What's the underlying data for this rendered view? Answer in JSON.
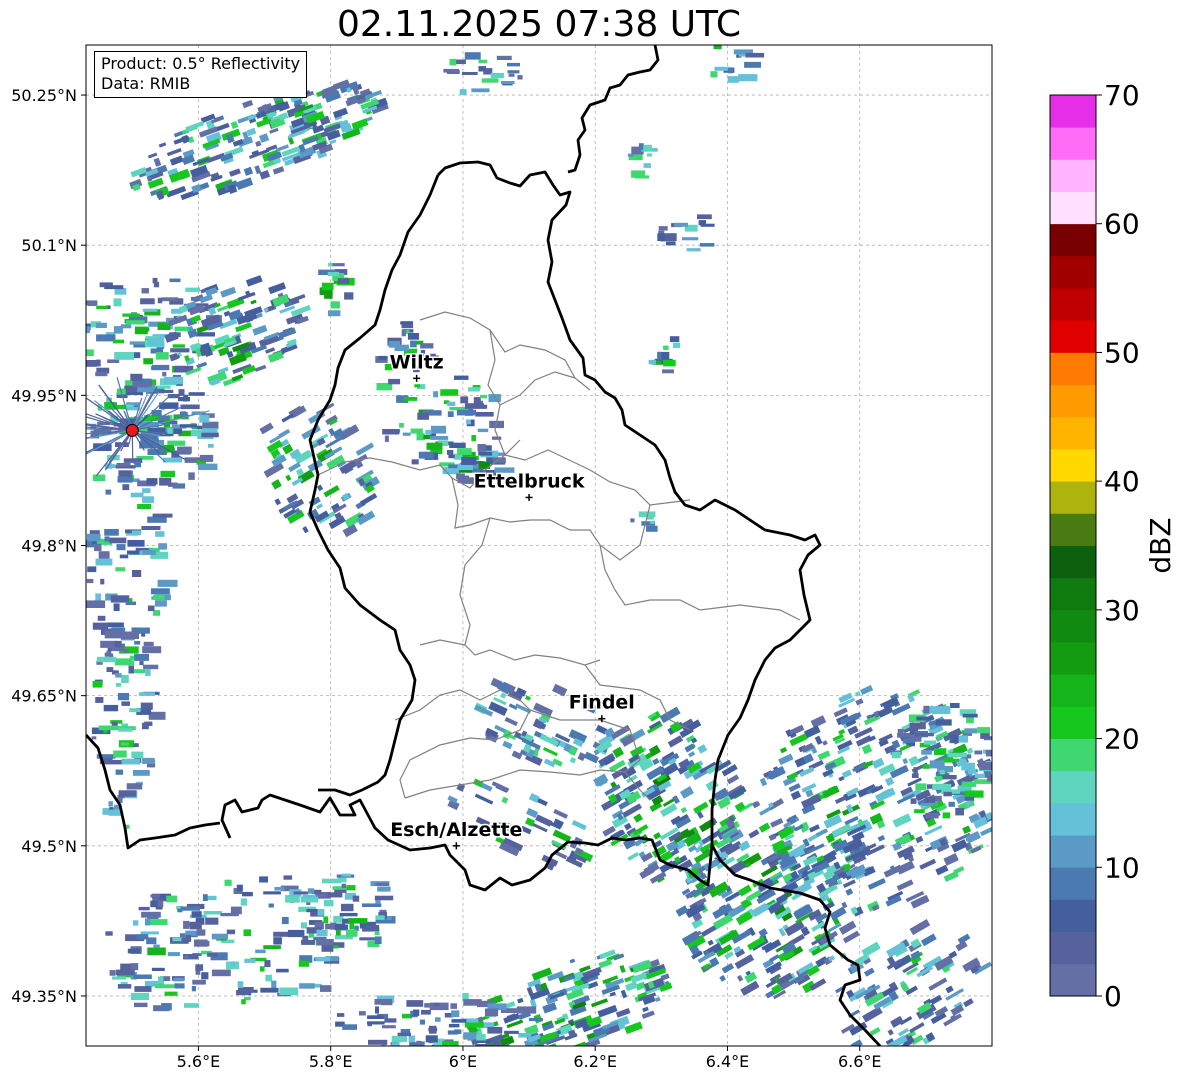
{
  "title": "02.11.2025 07:38 UTC",
  "info": {
    "product": "Product: 0.5° Reflectivity",
    "data": "Data: RMIB"
  },
  "map": {
    "lon_range": [
      5.43,
      6.8
    ],
    "lat_range": [
      49.3,
      50.3
    ],
    "lon_ticks": [
      {
        "value": 5.6,
        "label": "5.6°E"
      },
      {
        "value": 5.8,
        "label": "5.8°E"
      },
      {
        "value": 6.0,
        "label": "6°E"
      },
      {
        "value": 6.2,
        "label": "6.2°E"
      },
      {
        "value": 6.4,
        "label": "6.4°E"
      },
      {
        "value": 6.6,
        "label": "6.6°E"
      }
    ],
    "lat_ticks": [
      {
        "value": 50.25,
        "label": "50.25°N"
      },
      {
        "value": 50.1,
        "label": "50.1°N"
      },
      {
        "value": 49.95,
        "label": "49.95°N"
      },
      {
        "value": 49.8,
        "label": "49.8°N"
      },
      {
        "value": 49.65,
        "label": "49.65°N"
      },
      {
        "value": 49.5,
        "label": "49.5°N"
      },
      {
        "value": 49.35,
        "label": "49.35°N"
      }
    ],
    "gridlines": true,
    "radar_site": {
      "lon": 5.5,
      "lat": 49.915,
      "color": "#e41a1c"
    },
    "cities": [
      {
        "name": "Wiltz",
        "lon": 5.93,
        "lat": 49.967
      },
      {
        "name": "Ettelbruck",
        "lon": 6.1,
        "lat": 49.848
      },
      {
        "name": "Findel",
        "lon": 6.21,
        "lat": 49.627
      },
      {
        "name": "Esch/Alzette",
        "lon": 5.99,
        "lat": 49.5
      }
    ],
    "border_color": "#000000",
    "canton_border_color": "#808080"
  },
  "colorbar": {
    "label": "dBZ",
    "min": 0,
    "max": 70,
    "ticks": [
      {
        "value": 0,
        "label": "0"
      },
      {
        "value": 10,
        "label": "10"
      },
      {
        "value": 20,
        "label": "20"
      },
      {
        "value": 30,
        "label": "30"
      },
      {
        "value": 40,
        "label": "40"
      },
      {
        "value": 50,
        "label": "50"
      },
      {
        "value": 60,
        "label": "60"
      },
      {
        "value": 70,
        "label": "70"
      }
    ],
    "colors": [
      "#646fa5",
      "#56629e",
      "#455e9e",
      "#4b79b1",
      "#5b9ac6",
      "#65c1d8",
      "#5fd5c0",
      "#3ed770",
      "#16c81e",
      "#14b41a",
      "#139c12",
      "#108a11",
      "#0f7a0e",
      "#0d600e",
      "#4a7a12",
      "#aeb30e",
      "#ffd800",
      "#ffb400",
      "#ff9a00",
      "#ff7a00",
      "#e10000",
      "#c00000",
      "#a00000",
      "#780000",
      "#ffe0ff",
      "#ffb4ff",
      "#ff6cf7",
      "#e62ee8"
    ]
  }
}
